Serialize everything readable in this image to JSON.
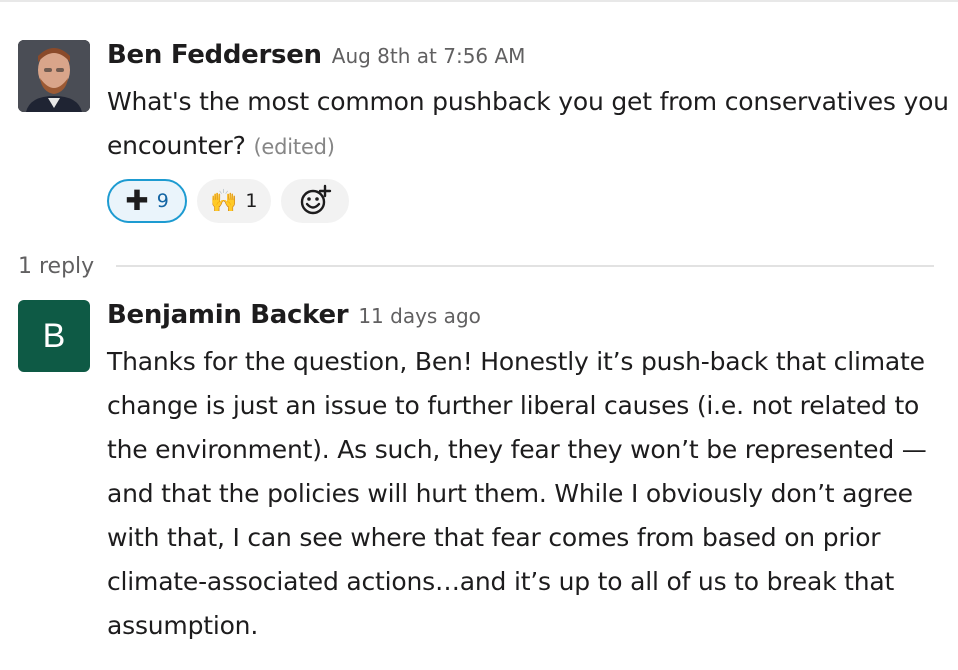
{
  "messages": [
    {
      "author": "Ben Feddersen",
      "timestamp": "Aug 8th at 7:56 AM",
      "text": "What's the most common pushback you get from conservatives you encounter?",
      "edited_label": "(edited)",
      "reactions": [
        {
          "emoji": "heavy-plus-sign",
          "count": "9",
          "active": true
        },
        {
          "emoji": "raised-hands",
          "glyph": "🙌",
          "count": "1",
          "active": false
        }
      ]
    },
    {
      "author": "Benjamin Backer",
      "avatar_letter": "B",
      "timestamp": "11 days ago",
      "text": "Thanks for the question, Ben! Honestly it’s push-back that climate change is just an issue to further liberal causes (i.e. not related to the environment). As such, they fear they won’t be represented — and that the policies will hurt them. While I obviously don’t agree with that, I can see where that fear comes from based on prior climate-associated actions…and it’s up to all of us to break that assumption."
    }
  ],
  "thread": {
    "replies_label": "1 reply"
  },
  "colors": {
    "avatar_b": "#0e5a45",
    "active_reaction_border": "#1d9bd1"
  }
}
